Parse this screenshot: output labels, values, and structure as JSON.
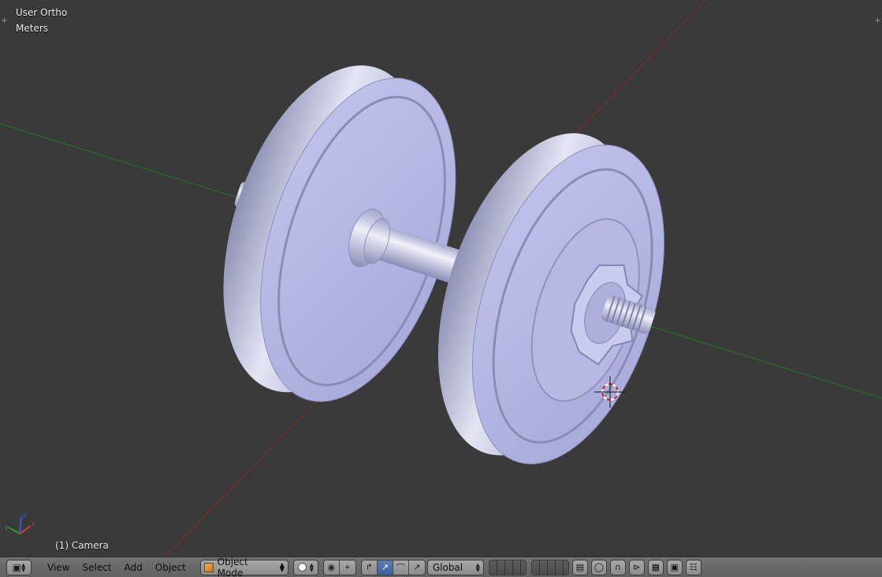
{
  "viewport": {
    "title": "User Ortho",
    "units": "Meters",
    "active_object": "(1) Camera",
    "background_color": "#3a3a3a",
    "object_color": "#b3b6e6",
    "x_axis_color": "#8b2a2a",
    "y_axis_color": "#1f7a1f"
  },
  "header": {
    "menus": [
      "View",
      "Select",
      "Add",
      "Object"
    ],
    "mode": "Object Mode",
    "orientation": "Global",
    "accent_color": "#4a70aa"
  },
  "icons": {
    "editor_type": "cube-icon",
    "mode": "object-mode-cube-icon",
    "shading": "solid-sphere-icon",
    "pivot": "pivot-point-icon",
    "manipulator": "manipulator-icon",
    "translate": "translate-arrow-icon",
    "rotate": "rotate-arc-icon",
    "scale": "scale-arrow-icon",
    "layers": "layers-grid-icon",
    "snap": "magnet-icon",
    "render": "render-camera-icon"
  }
}
